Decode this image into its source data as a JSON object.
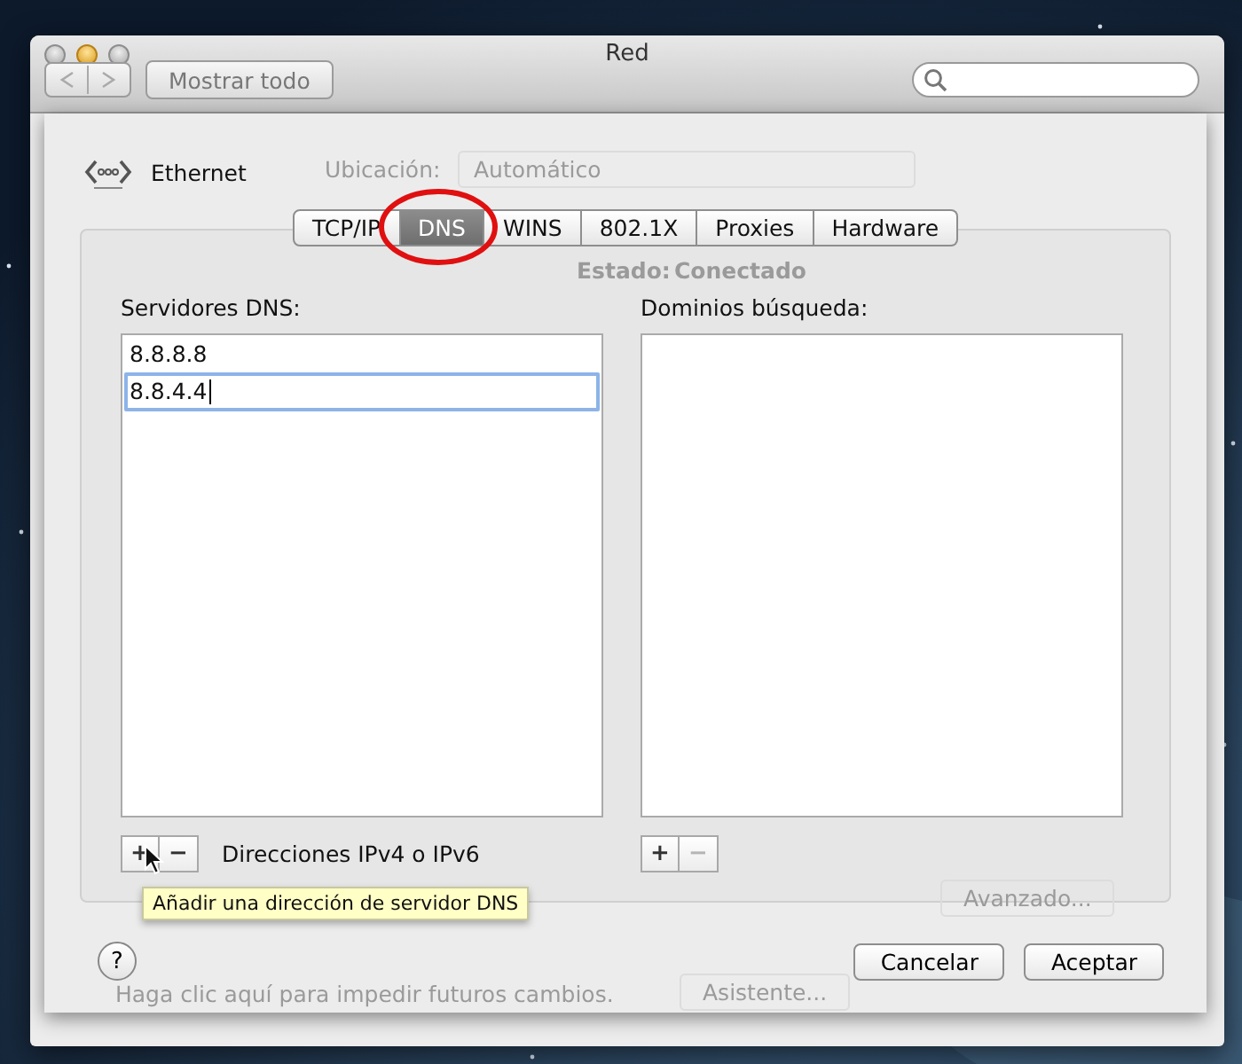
{
  "window": {
    "title": "Red",
    "show_all_button": "Mostrar todo"
  },
  "background": {
    "location_label": "Ubicación:",
    "location_value": "Automático",
    "status_label": "Estado:",
    "status_value": "Conectado",
    "advanced_button": "Avanzado...",
    "lock_text": "Haga clic aquí para impedir futuros cambios.",
    "assistant_button": "Asistente..."
  },
  "sheet": {
    "service": "Ethernet",
    "tabs": [
      {
        "label": "TCP/IP",
        "selected": false
      },
      {
        "label": "DNS",
        "selected": true
      },
      {
        "label": "WINS",
        "selected": false
      },
      {
        "label": "802.1X",
        "selected": false
      },
      {
        "label": "Proxies",
        "selected": false
      },
      {
        "label": "Hardware",
        "selected": false
      }
    ],
    "dns_servers": {
      "label": "Servidores DNS:",
      "entries": [
        {
          "value": "8.8.8.8",
          "editing": false
        },
        {
          "value": "8.8.4.4",
          "editing": true
        }
      ],
      "buttons": [
        {
          "label": "+",
          "disabled": false
        },
        {
          "label": "−",
          "disabled": false
        }
      ],
      "note": "Direcciones IPv4 o IPv6"
    },
    "search_domains": {
      "label": "Dominios búsqueda:",
      "buttons": [
        {
          "label": "+",
          "disabled": false
        },
        {
          "label": "−",
          "disabled": true
        }
      ]
    },
    "tooltip": "Añadir una dirección de servidor DNS",
    "help": "?",
    "buttons": [
      "Cancelar",
      "Aceptar"
    ]
  }
}
